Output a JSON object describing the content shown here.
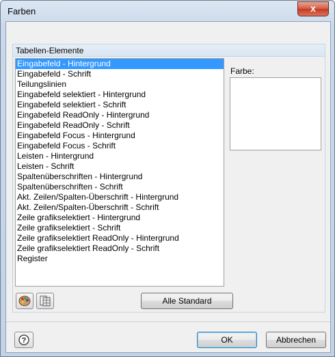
{
  "window": {
    "title": "Farben",
    "close_glyph": "x"
  },
  "group": {
    "title": "Tabellen-Elemente",
    "items": [
      "Eingabefeld - Hintergrund",
      "Eingabefeld - Schrift",
      "Teilungslinien",
      "Eingabefeld selektiert - Hintergrund",
      "Eingabefeld selektiert - Schrift",
      "Eingabefeld ReadOnly - Hintergrund",
      "Eingabefeld ReadOnly - Schrift",
      "Eingabefeld Focus - Hintergrund",
      "Eingabefeld Focus - Schrift",
      "Leisten - Hintergrund",
      "Leisten - Schrift",
      "Spaltenüberschriften - Hintergrund",
      "Spaltenüberschriften - Schrift",
      "Akt. Zeilen/Spalten-Überschrift - Hintergrund",
      "Akt. Zeilen/Spalten-Überschrift - Schrift",
      "Zeile grafikselektiert - Hintergrund",
      "Zeile grafikselektiert - Schrift",
      "Zeile grafikselektiert ReadOnly - Hintergrund",
      "Zeile grafikselektiert ReadOnly - Schrift",
      "Register"
    ],
    "selected_index": 0,
    "color_label": "Farbe:",
    "color_value": "#ffffff",
    "default_all_label": "Alle Standard"
  },
  "icons": {
    "palette": "palette-icon",
    "copy_table": "table-copy-icon",
    "help": "help-icon"
  },
  "buttons": {
    "ok": "OK",
    "cancel": "Abbrechen"
  }
}
